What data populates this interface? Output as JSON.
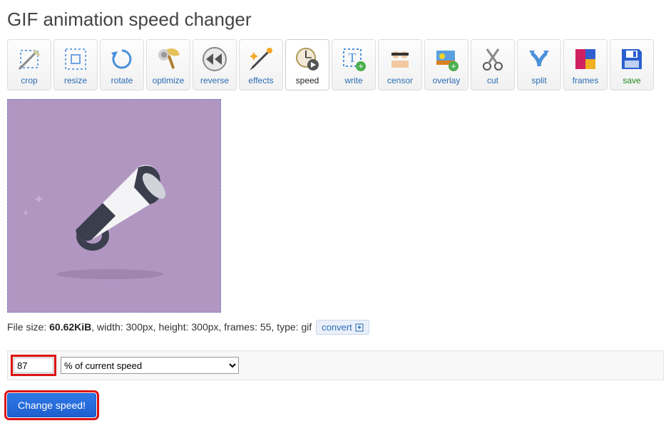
{
  "title": "GIF animation speed changer",
  "toolbar": [
    {
      "id": "crop",
      "label": "crop"
    },
    {
      "id": "resize",
      "label": "resize"
    },
    {
      "id": "rotate",
      "label": "rotate"
    },
    {
      "id": "optimize",
      "label": "optimize"
    },
    {
      "id": "reverse",
      "label": "reverse"
    },
    {
      "id": "effects",
      "label": "effects"
    },
    {
      "id": "speed",
      "label": "speed",
      "active": true
    },
    {
      "id": "write",
      "label": "write"
    },
    {
      "id": "censor",
      "label": "censor"
    },
    {
      "id": "overlay",
      "label": "overlay"
    },
    {
      "id": "cut",
      "label": "cut"
    },
    {
      "id": "split",
      "label": "split"
    },
    {
      "id": "frames",
      "label": "frames"
    },
    {
      "id": "save",
      "label": "save"
    }
  ],
  "fileinfo": {
    "prefix": "File size: ",
    "size": "60.62KiB",
    "rest": ", width: 300px, height: 300px, frames: 55, type: gif",
    "convert_label": "convert"
  },
  "form": {
    "speed_value": "87",
    "select_option": "% of current speed",
    "submit_label": "Change speed!"
  }
}
